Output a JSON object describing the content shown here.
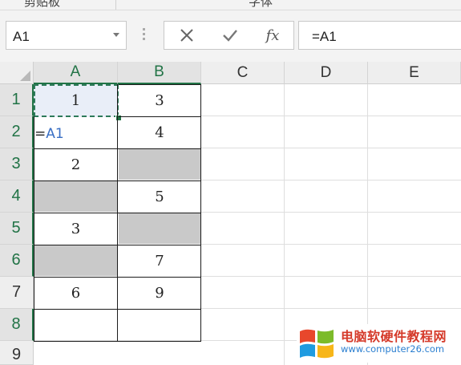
{
  "ribbon": {
    "group1": "剪贴板",
    "group2": "字体"
  },
  "name_box": {
    "value": "A1"
  },
  "formula_bar": {
    "cancel_icon": "x-icon",
    "confirm_icon": "check-icon",
    "fx_label": "fx",
    "value": "=A1"
  },
  "columns": [
    "A",
    "B",
    "C",
    "D",
    "E"
  ],
  "rows": [
    "1",
    "2",
    "3",
    "4",
    "5",
    "6",
    "7",
    "8",
    "9"
  ],
  "cells": {
    "A1": "1",
    "B1": "3",
    "A2": "=",
    "A2_ref": "A1",
    "B2": "4",
    "A3": "2",
    "B3": "",
    "A4": "",
    "B4": "5",
    "A5": "3",
    "B5": "",
    "A6": "",
    "B6": "7",
    "A7": "6",
    "B7": "9",
    "A8": "",
    "B8": ""
  },
  "colors": {
    "accent": "#217346",
    "empty_fill": "#c9c9c9",
    "ref_text": "#3a6fc4"
  },
  "watermark": {
    "title": "电脑软硬件教程网",
    "url": "www.computer26.com"
  }
}
